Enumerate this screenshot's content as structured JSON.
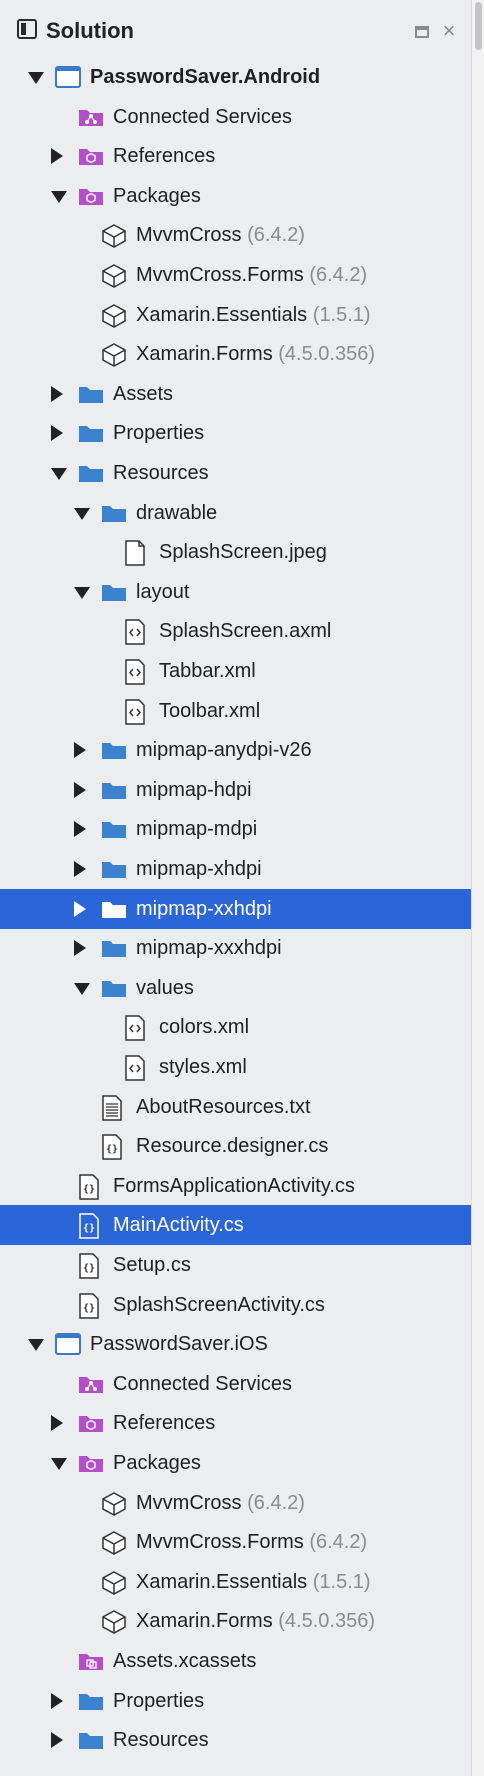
{
  "panel": {
    "title": "Solution"
  },
  "rows": [
    {
      "label": "PasswordSaver.Android",
      "version": "",
      "bold": true,
      "indent": 0,
      "arrow": "down",
      "icon": "project-icon",
      "selected": false
    },
    {
      "label": "Connected Services",
      "version": "",
      "indent": 1,
      "arrow": "none",
      "icon": "connected-services-icon",
      "selected": false
    },
    {
      "label": "References",
      "version": "",
      "indent": 1,
      "arrow": "right",
      "icon": "references-icon",
      "selected": false
    },
    {
      "label": "Packages",
      "version": "",
      "indent": 1,
      "arrow": "down",
      "icon": "packages-icon",
      "selected": false
    },
    {
      "label": "MvvmCross",
      "version": "(6.4.2)",
      "indent": 2,
      "arrow": "none",
      "icon": "package-icon",
      "selected": false
    },
    {
      "label": "MvvmCross.Forms",
      "version": "(6.4.2)",
      "indent": 2,
      "arrow": "none",
      "icon": "package-icon",
      "selected": false
    },
    {
      "label": "Xamarin.Essentials",
      "version": "(1.5.1)",
      "indent": 2,
      "arrow": "none",
      "icon": "package-icon",
      "selected": false
    },
    {
      "label": "Xamarin.Forms",
      "version": "(4.5.0.356)",
      "indent": 2,
      "arrow": "none",
      "icon": "package-icon",
      "selected": false
    },
    {
      "label": "Assets",
      "version": "",
      "indent": 1,
      "arrow": "right",
      "icon": "folder-icon",
      "selected": false
    },
    {
      "label": "Properties",
      "version": "",
      "indent": 1,
      "arrow": "right",
      "icon": "folder-icon",
      "selected": false
    },
    {
      "label": "Resources",
      "version": "",
      "indent": 1,
      "arrow": "down",
      "icon": "folder-icon",
      "selected": false
    },
    {
      "label": "drawable",
      "version": "",
      "indent": 2,
      "arrow": "down",
      "icon": "folder-icon",
      "selected": false
    },
    {
      "label": "SplashScreen.jpeg",
      "version": "",
      "indent": 3,
      "arrow": "none",
      "icon": "file-icon",
      "selected": false
    },
    {
      "label": "layout",
      "version": "",
      "indent": 2,
      "arrow": "down",
      "icon": "folder-icon",
      "selected": false
    },
    {
      "label": "SplashScreen.axml",
      "version": "",
      "indent": 3,
      "arrow": "none",
      "icon": "xml-file-icon",
      "selected": false
    },
    {
      "label": "Tabbar.xml",
      "version": "",
      "indent": 3,
      "arrow": "none",
      "icon": "xml-file-icon",
      "selected": false
    },
    {
      "label": "Toolbar.xml",
      "version": "",
      "indent": 3,
      "arrow": "none",
      "icon": "xml-file-icon",
      "selected": false
    },
    {
      "label": "mipmap-anydpi-v26",
      "version": "",
      "indent": 2,
      "arrow": "right",
      "icon": "folder-icon",
      "selected": false
    },
    {
      "label": "mipmap-hdpi",
      "version": "",
      "indent": 2,
      "arrow": "right",
      "icon": "folder-icon",
      "selected": false
    },
    {
      "label": "mipmap-mdpi",
      "version": "",
      "indent": 2,
      "arrow": "right",
      "icon": "folder-icon",
      "selected": false
    },
    {
      "label": "mipmap-xhdpi",
      "version": "",
      "indent": 2,
      "arrow": "right",
      "icon": "folder-icon",
      "selected": false
    },
    {
      "label": "mipmap-xxhdpi",
      "version": "",
      "indent": 2,
      "arrow": "right",
      "icon": "folder-icon",
      "selected": true
    },
    {
      "label": "mipmap-xxxhdpi",
      "version": "",
      "indent": 2,
      "arrow": "right",
      "icon": "folder-icon",
      "selected": false
    },
    {
      "label": "values",
      "version": "",
      "indent": 2,
      "arrow": "down",
      "icon": "folder-icon",
      "selected": false
    },
    {
      "label": "colors.xml",
      "version": "",
      "indent": 3,
      "arrow": "none",
      "icon": "xml-file-icon",
      "selected": false
    },
    {
      "label": "styles.xml",
      "version": "",
      "indent": 3,
      "arrow": "none",
      "icon": "xml-file-icon",
      "selected": false
    },
    {
      "label": "AboutResources.txt",
      "version": "",
      "indent": 2,
      "arrow": "none",
      "icon": "text-file-icon",
      "selected": false
    },
    {
      "label": "Resource.designer.cs",
      "version": "",
      "indent": 2,
      "arrow": "none",
      "icon": "csharp-file-icon",
      "selected": false
    },
    {
      "label": "FormsApplicationActivity.cs",
      "version": "",
      "indent": 1,
      "arrow": "none",
      "icon": "csharp-file-icon",
      "selected": false
    },
    {
      "label": "MainActivity.cs",
      "version": "",
      "indent": 1,
      "arrow": "none",
      "icon": "csharp-file-icon",
      "selected": true
    },
    {
      "label": "Setup.cs",
      "version": "",
      "indent": 1,
      "arrow": "none",
      "icon": "csharp-file-icon",
      "selected": false
    },
    {
      "label": "SplashScreenActivity.cs",
      "version": "",
      "indent": 1,
      "arrow": "none",
      "icon": "csharp-file-icon",
      "selected": false
    },
    {
      "label": "PasswordSaver.iOS",
      "version": "",
      "bold": false,
      "indent": 0,
      "arrow": "down",
      "icon": "project-icon",
      "selected": false
    },
    {
      "label": "Connected Services",
      "version": "",
      "indent": 1,
      "arrow": "none",
      "icon": "connected-services-icon",
      "selected": false
    },
    {
      "label": "References",
      "version": "",
      "indent": 1,
      "arrow": "right",
      "icon": "references-icon",
      "selected": false
    },
    {
      "label": "Packages",
      "version": "",
      "indent": 1,
      "arrow": "down",
      "icon": "packages-icon",
      "selected": false
    },
    {
      "label": "MvvmCross",
      "version": "(6.4.2)",
      "indent": 2,
      "arrow": "none",
      "icon": "package-icon",
      "selected": false
    },
    {
      "label": "MvvmCross.Forms",
      "version": "(6.4.2)",
      "indent": 2,
      "arrow": "none",
      "icon": "package-icon",
      "selected": false
    },
    {
      "label": "Xamarin.Essentials",
      "version": "(1.5.1)",
      "indent": 2,
      "arrow": "none",
      "icon": "package-icon",
      "selected": false
    },
    {
      "label": "Xamarin.Forms",
      "version": "(4.5.0.356)",
      "indent": 2,
      "arrow": "none",
      "icon": "package-icon",
      "selected": false
    },
    {
      "label": "Assets.xcassets",
      "version": "",
      "indent": 1,
      "arrow": "none",
      "icon": "asset-catalog-icon",
      "selected": false
    },
    {
      "label": "Properties",
      "version": "",
      "indent": 1,
      "arrow": "right",
      "icon": "folder-icon",
      "selected": false
    },
    {
      "label": "Resources",
      "version": "",
      "indent": 1,
      "arrow": "right",
      "icon": "folder-icon",
      "selected": false
    }
  ],
  "colors": {
    "selection": "#2b66d9",
    "folder": "#3b82cf",
    "purple": "#b34fc7",
    "version": "#8b8b8f"
  }
}
